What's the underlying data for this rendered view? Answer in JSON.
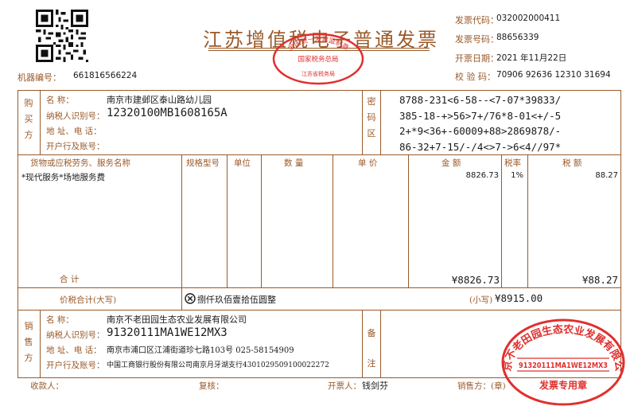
{
  "header": {
    "title": "江苏增值税电子普通发票",
    "machine_label": "机器编号：",
    "machine_no": "661816566224",
    "code_label": "发票代码：",
    "code": "032002000411",
    "number_label": "发票号码：",
    "number": "88656339",
    "date_label": "开票日期：",
    "date": "2021 年11月22日",
    "check_label": "校 验 码：",
    "check": "70906 92636 12310 31694"
  },
  "tax_seal": {
    "text_top": "全国统一发票监制章",
    "text_mid": "国家税务总局",
    "text_bottom": "江苏省税务局",
    "color": "#e0302e"
  },
  "buyer": {
    "section_label": "购买方",
    "name_label": "名        称：",
    "name": "南京市建邺区泰山路幼儿园",
    "taxid_label": "纳税人识别号：",
    "taxid": "12320100MB1608165A",
    "addr_label": "地 址、电 话：",
    "bank_label": "开户行及账号："
  },
  "cipher": {
    "section_label": "密码区",
    "lines": [
      "8788-231<6-58--<7-07*39833/",
      "385-18-+>56>7+/76*8-01<+/-5",
      "2+*9<36+-60009+88>2869878/-",
      "86-32+7-15/-/4<>7->6<4//97*"
    ]
  },
  "items_header": {
    "name": "货物或应税劳务、服务名称",
    "spec": "规格型号",
    "unit": "单位",
    "qty": "数  量",
    "price": "单  价",
    "amount": "金  额",
    "rate": "税率",
    "tax": "税  额"
  },
  "items": [
    {
      "name": "*现代服务*场地服务费",
      "amount": "8826.73",
      "rate": "1%",
      "tax": "88.27"
    }
  ],
  "totals": {
    "label": "合      计",
    "amount": "¥8826.73",
    "tax": "¥88.27"
  },
  "grand_total": {
    "label": "价税合计(大写)",
    "words": "捌仟玖佰壹拾伍圆整",
    "small_label": "(小写)",
    "small": "¥8915.00"
  },
  "seller": {
    "section_label": "销售方",
    "name_label": "名        称：",
    "name": "南京不老田园生态农业发展有限公司",
    "taxid_label": "纳税人识别号：",
    "taxid": "91320111MA1WE12MX3",
    "addr_label": "地 址、电 话：",
    "addr": "南京市浦口区江浦街道珍七路103号 025-58154909",
    "bank_label": "开户行及账号：",
    "bank": "中国工商银行股份有限公司南京月牙湖支行4301029509100022272"
  },
  "remarks": {
    "label": "备注"
  },
  "seller_seal": {
    "company": "南京不老田园生态农业发展有限公司",
    "taxid": "91320111MA1WE12MX3",
    "type": "发票专用章",
    "color": "#e0302e"
  },
  "footer": {
    "payee_label": "收款人：",
    "reviewer_label": "复核：",
    "issuer_label": "开票人：",
    "issuer": "钱剑芬",
    "seller_label": "销售方：(章)"
  }
}
